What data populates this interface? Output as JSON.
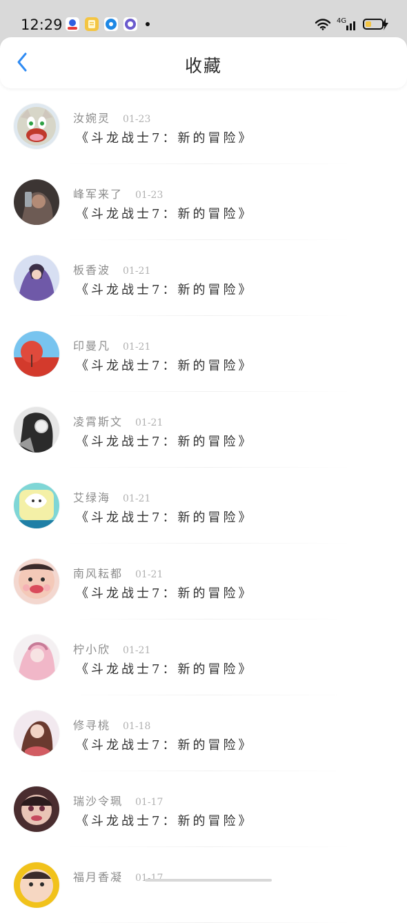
{
  "status": {
    "time": "12:29",
    "network": "4G"
  },
  "header": {
    "title": "收藏"
  },
  "items": [
    {
      "name": "汝婉灵",
      "date": "01-23",
      "title": "《斗龙战士7：新的冒险》"
    },
    {
      "name": "峰军来了",
      "date": "01-23",
      "title": "《斗龙战士7：新的冒险》"
    },
    {
      "name": "板香波",
      "date": "01-21",
      "title": "《斗龙战士7：新的冒险》"
    },
    {
      "name": "印曼凡",
      "date": "01-21",
      "title": "《斗龙战士7：新的冒险》"
    },
    {
      "name": "凌霄斯文",
      "date": "01-21",
      "title": "《斗龙战士7：新的冒险》"
    },
    {
      "name": "艾绿海",
      "date": "01-21",
      "title": "《斗龙战士7：新的冒险》"
    },
    {
      "name": "南风耘都",
      "date": "01-21",
      "title": "《斗龙战士7：新的冒险》"
    },
    {
      "name": "柠小欣",
      "date": "01-21",
      "title": "《斗龙战士7：新的冒险》"
    },
    {
      "name": "修寻桃",
      "date": "01-18",
      "title": "《斗龙战士7：新的冒险》"
    },
    {
      "name": "瑞沙令珮",
      "date": "01-17",
      "title": "《斗龙战士7：新的冒险》"
    },
    {
      "name": "福月香凝",
      "date": "01-17",
      "title": ""
    }
  ]
}
